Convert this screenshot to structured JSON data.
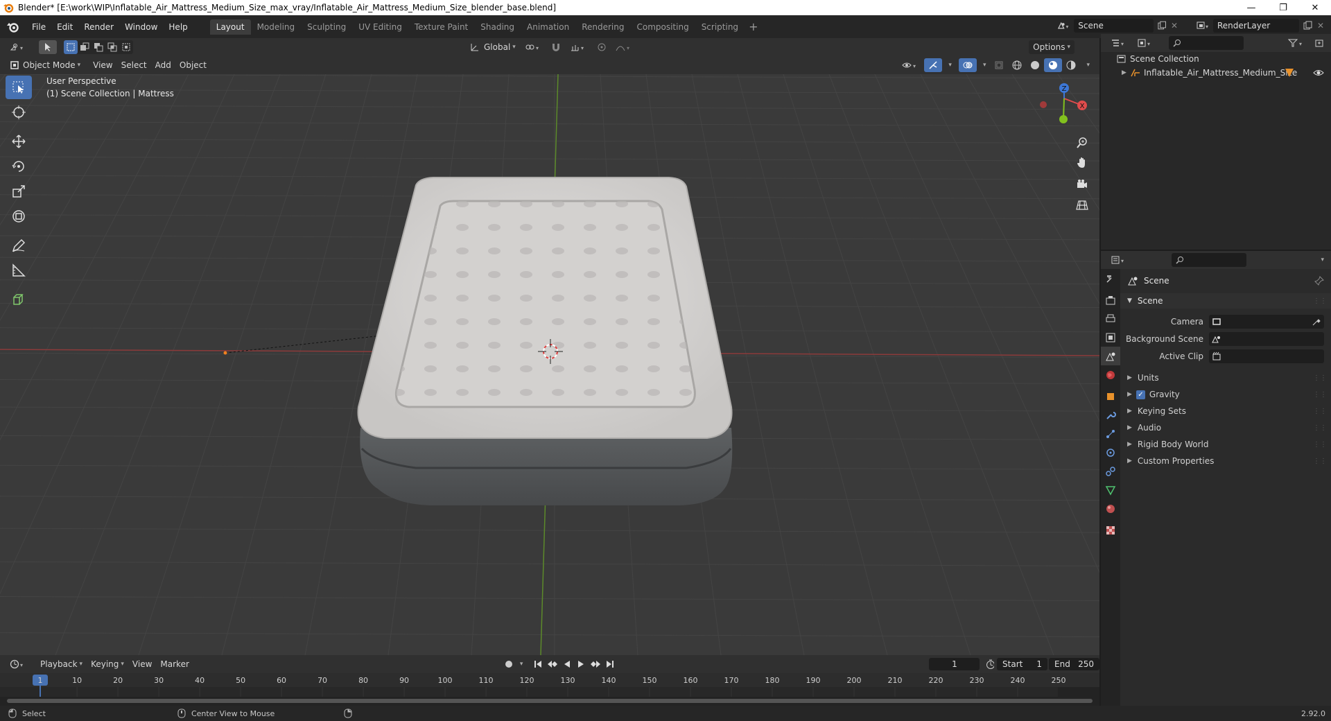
{
  "window": {
    "title": "Blender* [E:\\work\\WIP\\Inflatable_Air_Mattress_Medium_Size_max_vray/Inflatable_Air_Mattress_Medium_Size_blender_base.blend]",
    "minimize": "—",
    "maximize": "❐",
    "close": "✕"
  },
  "menu": [
    "File",
    "Edit",
    "Render",
    "Window",
    "Help"
  ],
  "workspaces": [
    "Layout",
    "Modeling",
    "Sculpting",
    "UV Editing",
    "Texture Paint",
    "Shading",
    "Animation",
    "Rendering",
    "Compositing",
    "Scripting"
  ],
  "active_workspace": "Layout",
  "scene_name": "Scene",
  "render_layer": "RenderLayer",
  "viewport": {
    "mode": "Object Mode",
    "menus": [
      "View",
      "Select",
      "Add",
      "Object"
    ],
    "transform_orientation": "Global",
    "options_label": "Options",
    "perspective_label": "User Perspective",
    "collection_label": "(1) Scene Collection | Mattress",
    "gizmo": {
      "x": "X",
      "y": "Y",
      "z": "Z"
    }
  },
  "outliner": {
    "root": "Scene Collection",
    "items": [
      "Inflatable_Air_Mattress_Medium_Size"
    ]
  },
  "properties": {
    "context": "Scene",
    "panel": "Scene",
    "fields": [
      {
        "label": "Camera",
        "value": ""
      },
      {
        "label": "Background Scene",
        "value": ""
      },
      {
        "label": "Active Clip",
        "value": ""
      }
    ],
    "subpanels": [
      {
        "label": "Units",
        "checkbox": false
      },
      {
        "label": "Gravity",
        "checkbox": true
      },
      {
        "label": "Keying Sets",
        "checkbox": false
      },
      {
        "label": "Audio",
        "checkbox": false
      },
      {
        "label": "Rigid Body World",
        "checkbox": false
      },
      {
        "label": "Custom Properties",
        "checkbox": false
      }
    ]
  },
  "timeline": {
    "menus": [
      "Playback",
      "Keying",
      "View",
      "Marker"
    ],
    "current_frame": "1",
    "start_label": "Start",
    "start": "1",
    "end_label": "End",
    "end": "250",
    "ticks": [
      "1",
      "10",
      "20",
      "30",
      "40",
      "50",
      "60",
      "70",
      "80",
      "90",
      "100",
      "110",
      "120",
      "130",
      "140",
      "150",
      "160",
      "170",
      "180",
      "190",
      "200",
      "210",
      "220",
      "230",
      "240",
      "250"
    ]
  },
  "statusbar": {
    "select": "Select",
    "center_view": "Center View to Mouse",
    "version": "2.92.0"
  }
}
